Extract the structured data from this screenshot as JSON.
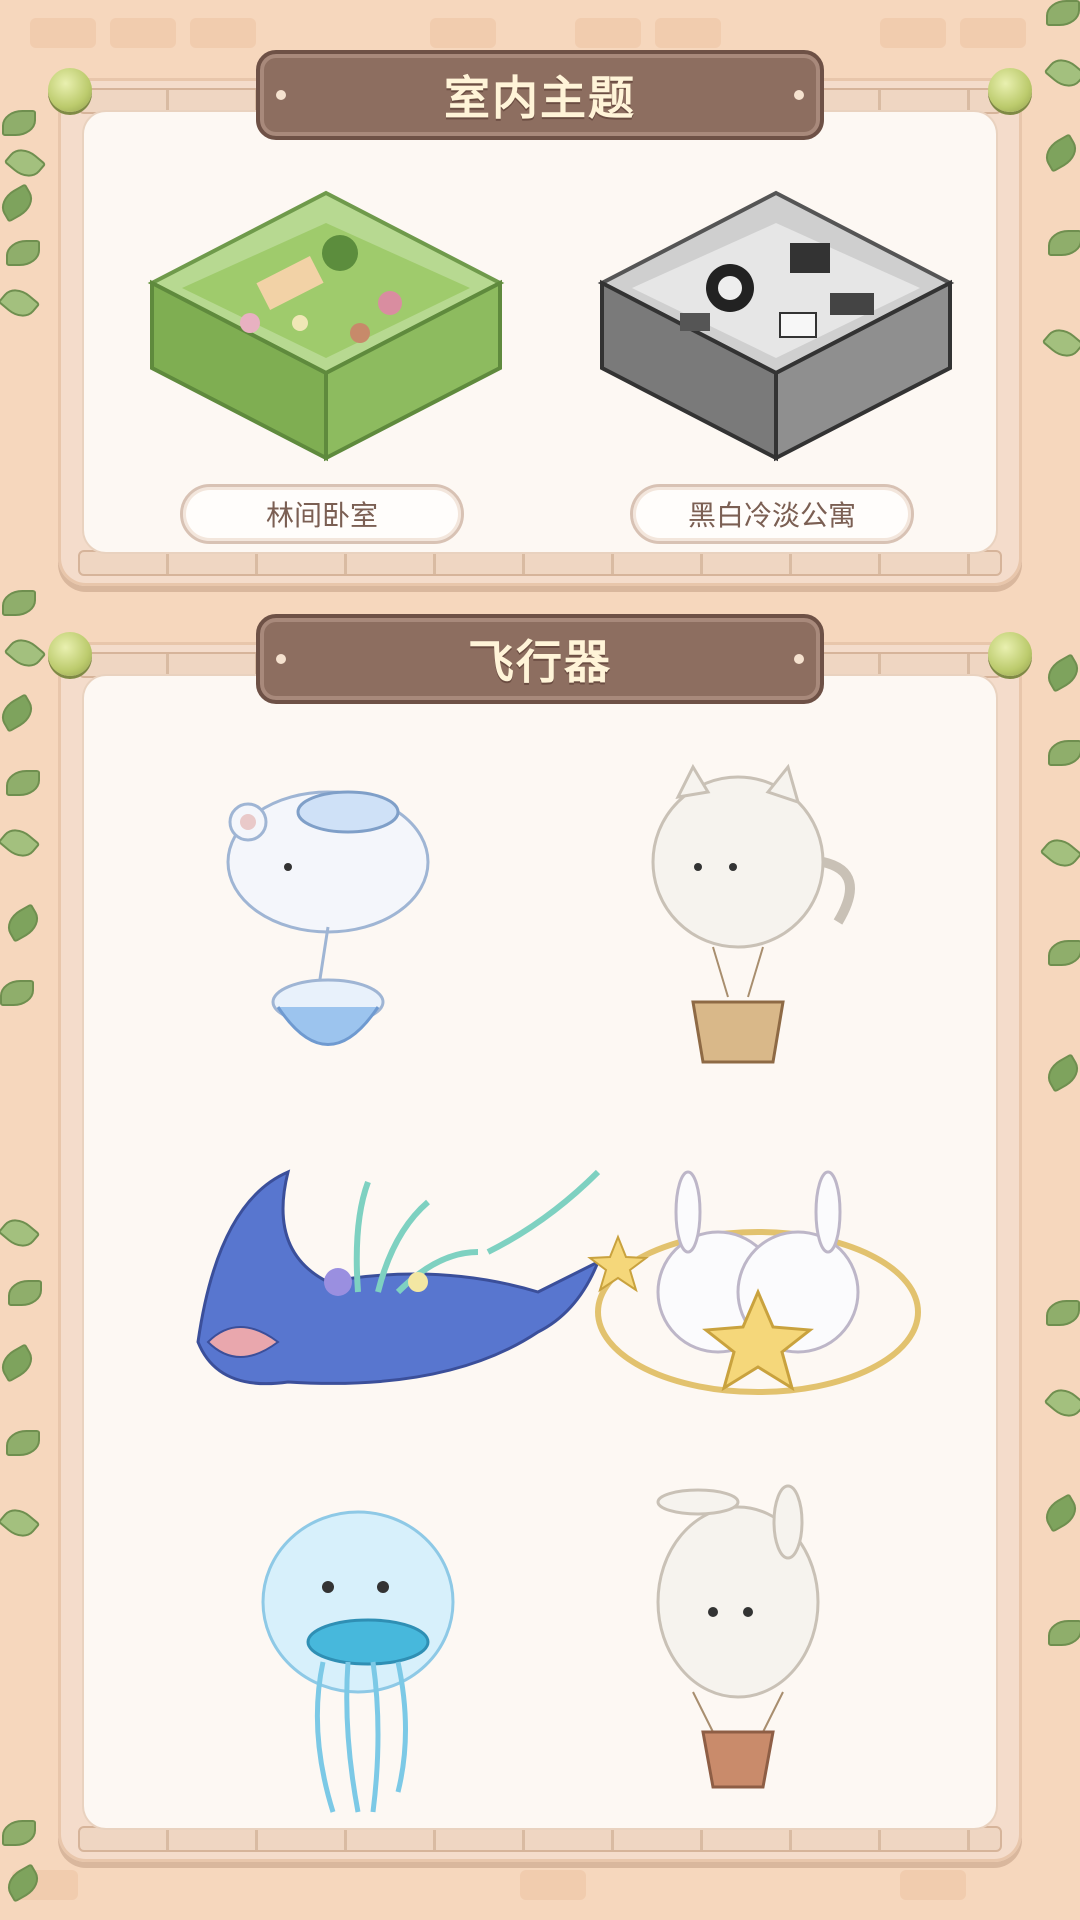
{
  "sections": [
    {
      "title": "室内主题",
      "rooms": [
        {
          "label": "林间卧室",
          "icon": "forest-bedroom-room-image",
          "floor_color": "#8dbb5f",
          "wall_color": "#b7d991"
        },
        {
          "label": "黑白冷淡公寓",
          "icon": "monochrome-apartment-room-image",
          "floor_color": "#8f8f8f",
          "wall_color": "#cfcfcf"
        }
      ]
    },
    {
      "title": "飞行器",
      "aircraft": [
        {
          "icon": "polar-bear-airship-icon"
        },
        {
          "icon": "cat-hot-air-balloon-icon"
        },
        {
          "icon": "manta-ray-coral-airship-icon"
        },
        {
          "icon": "bunny-star-ring-vehicle-icon"
        },
        {
          "icon": "jellyfish-airship-icon"
        },
        {
          "icon": "bunny-hot-air-balloon-icon"
        }
      ]
    }
  ],
  "colors": {
    "background": "#f6d7bd",
    "plaque": "#8d6e60",
    "plaque_text": "#fff4d8",
    "panel": "#fdf8f3",
    "label_text": "#7b5f53"
  }
}
